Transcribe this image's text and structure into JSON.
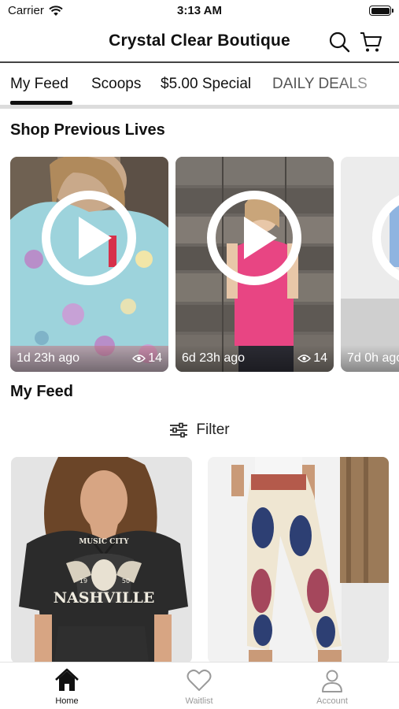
{
  "status_bar": {
    "carrier": "Carrier",
    "time": "3:13 AM"
  },
  "header": {
    "title": "Crystal Clear Boutique",
    "icons": [
      "search-icon",
      "cart-icon"
    ]
  },
  "tabs": [
    {
      "label": "My Feed",
      "active": true
    },
    {
      "label": "Scoops",
      "active": false
    },
    {
      "label": "$5.00 Special",
      "active": false
    },
    {
      "label": "DAILY DEALS",
      "active": false
    }
  ],
  "previous_lives": {
    "title": "Shop Previous Lives",
    "items": [
      {
        "time_ago": "1d 23h ago",
        "views": "14"
      },
      {
        "time_ago": "6d 23h ago",
        "views": "14"
      },
      {
        "time_ago": "7d 0h ago",
        "views": ""
      }
    ]
  },
  "feed": {
    "title": "My Feed",
    "filter_label": "Filter",
    "products": [
      {
        "print_text_1": "MUSIC CITY",
        "print_text_2": "NASHVILLE",
        "print_year_left": "19",
        "print_year_right": "50"
      },
      {}
    ]
  },
  "tabbar": {
    "items": [
      {
        "label": "Home",
        "icon": "home-icon",
        "active": true
      },
      {
        "label": "Waitlist",
        "icon": "heart-icon",
        "active": false
      },
      {
        "label": "Account",
        "icon": "user-icon",
        "active": false
      }
    ]
  },
  "colors": {
    "accent": "#111111",
    "inactive": "#9a9a9a",
    "divider": "#dcdcdc"
  }
}
